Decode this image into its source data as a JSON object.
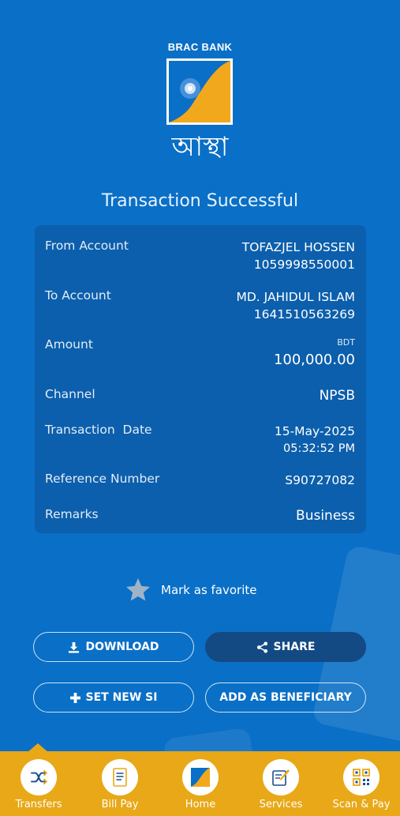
{
  "brand": {
    "name": "BRAC BANK",
    "product": "আস্থা"
  },
  "title": "Transaction Successful",
  "details": [
    {
      "label": "From Account",
      "line1": "TOFAZJEL HOSSEN",
      "line2": "1059998550001"
    },
    {
      "label": "To Account",
      "line1": "MD. JAHIDUL ISLAM",
      "line2": "1641510563269"
    },
    {
      "label": "Amount",
      "currency": "BDT",
      "value": "100,000.00"
    },
    {
      "label": "Channel",
      "value": "NPSB"
    },
    {
      "label": "Transaction  Date",
      "line1": "15-May-2025",
      "line2": "05:32:52 PM"
    },
    {
      "label": "Reference Number",
      "value": "S90727082"
    },
    {
      "label": "Remarks",
      "value": "Business"
    }
  ],
  "favorite_label": "Mark as favorite",
  "buttons": {
    "download": "DOWNLOAD",
    "share": "SHARE",
    "set_new_si": "SET NEW SI",
    "add_beneficiary": "ADD AS BENEFICIARY"
  },
  "nav": [
    {
      "label": "Transfers",
      "icon": "shuffle-icon"
    },
    {
      "label": "Bill Pay",
      "icon": "bill-icon"
    },
    {
      "label": "Home",
      "icon": "home-logo-icon"
    },
    {
      "label": "Services",
      "icon": "services-icon"
    },
    {
      "label": "Scan & Pay",
      "icon": "qr-icon"
    }
  ],
  "colors": {
    "background": "#0a6fc6",
    "card": "#0c5fac",
    "nav": "#e8a817",
    "accent_dark": "#144a83"
  }
}
